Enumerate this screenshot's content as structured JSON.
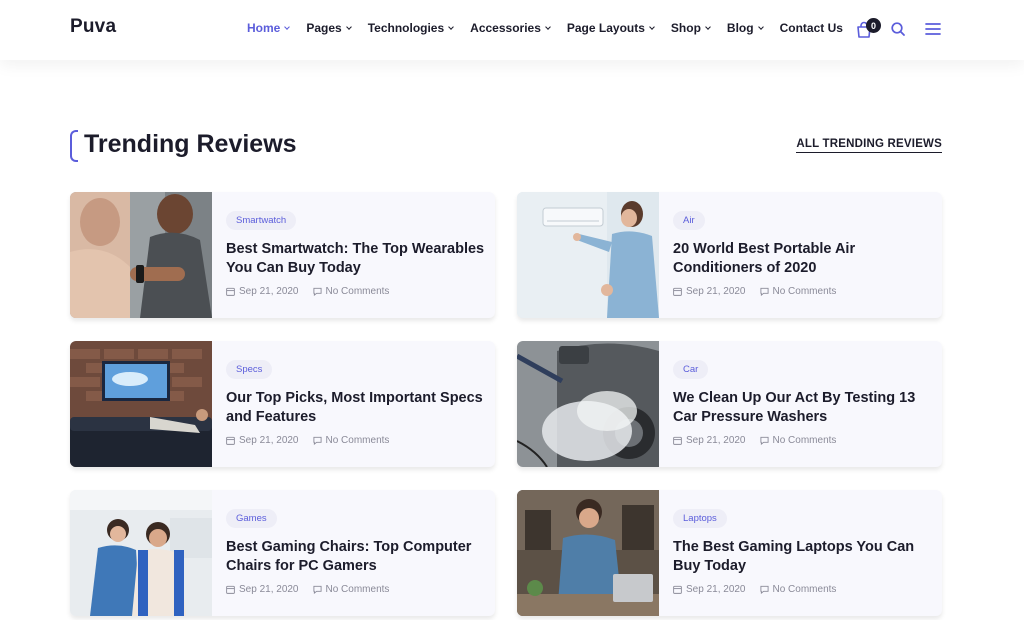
{
  "brand": {
    "logo": "Puva",
    "accent": "#5b5ddb"
  },
  "nav": [
    {
      "label": "Home",
      "active": true
    },
    {
      "label": "Pages"
    },
    {
      "label": "Technologies"
    },
    {
      "label": "Accessories"
    },
    {
      "label": "Page Layouts"
    },
    {
      "label": "Shop"
    },
    {
      "label": "Blog"
    },
    {
      "label": "Contact Us"
    }
  ],
  "header_icons": {
    "cart_count": "0",
    "cart_icon": "shopping-bag-icon",
    "search_icon": "search-icon",
    "menu_icon": "hamburger-menu-icon"
  },
  "section": {
    "title": "Trending Reviews",
    "link": "ALL TRENDING REVIEWS"
  },
  "cards": [
    {
      "tag": "Smartwatch",
      "title": "Best Smartwatch: The Top Wearables You Can Buy Today",
      "date": "Sep 21, 2020",
      "comments": "No Comments"
    },
    {
      "tag": "Air",
      "title": "20 World Best Portable Air Conditioners of 2020",
      "date": "Sep 21, 2020",
      "comments": "No Comments"
    },
    {
      "tag": "Specs",
      "title": "Our Top Picks, Most Important Specs and Features",
      "date": "Sep 21, 2020",
      "comments": "No Comments"
    },
    {
      "tag": "Car",
      "title": "We Clean Up Our Act By Testing 13 Car Pressure Washers",
      "date": "Sep 21, 2020",
      "comments": "No Comments"
    },
    {
      "tag": "Games",
      "title": "Best Gaming Chairs: Top Computer Chairs for PC Gamers",
      "date": "Sep 21, 2020",
      "comments": "No Comments"
    },
    {
      "tag": "Laptops",
      "title": "The Best Gaming Laptops You Can Buy Today",
      "date": "Sep 21, 2020",
      "comments": "No Comments"
    }
  ]
}
